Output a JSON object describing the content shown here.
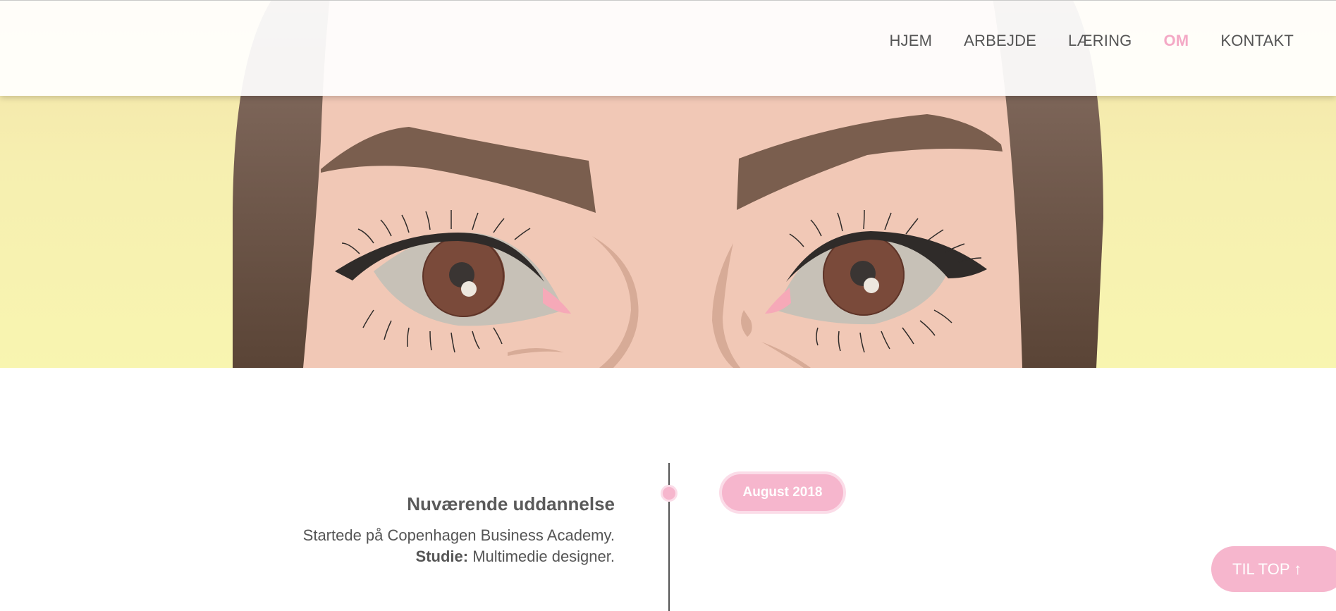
{
  "nav": {
    "items": [
      {
        "label": "HJEM",
        "active": false
      },
      {
        "label": "ARBEJDE",
        "active": false
      },
      {
        "label": "LÆRING",
        "active": false
      },
      {
        "label": "OM",
        "active": true
      },
      {
        "label": "KONTAKT",
        "active": false
      }
    ]
  },
  "timeline": {
    "date": "August 2018",
    "title": "Nuværende uddannelse",
    "line1": "Startede på Copenhagen Business Academy.",
    "study_label": "Studie:",
    "study_value": " Multimedie designer."
  },
  "to_top": {
    "label": "TIL TOP ↑"
  },
  "colors": {
    "accent": "#f6b6cd",
    "text": "#555555",
    "hero_bg": "#f6efb0",
    "hair": "#6b5446",
    "skin": "#f1c8b6",
    "iris": "#7a4a3a"
  },
  "icons": {
    "to_top": "arrow-up-icon"
  }
}
